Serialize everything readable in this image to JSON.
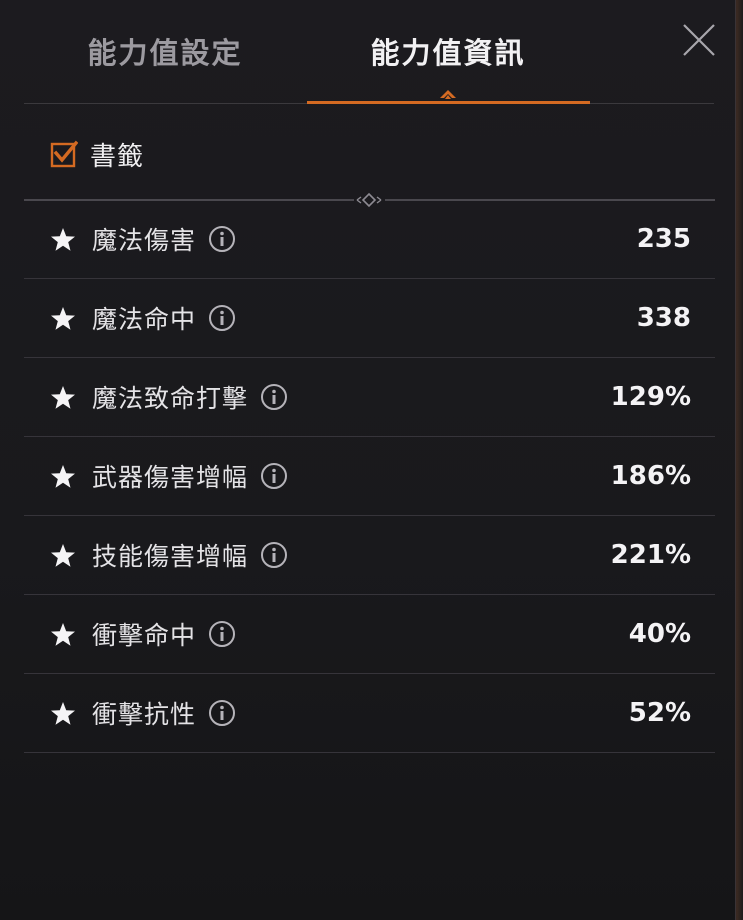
{
  "tabs": {
    "stat_settings": "能力值設定",
    "stat_info": "能力值資訊",
    "active": "stat_info"
  },
  "bookmark": {
    "label": "書籤",
    "checked": true
  },
  "stats": [
    {
      "label": "魔法傷害",
      "value": "235"
    },
    {
      "label": "魔法命中",
      "value": "338"
    },
    {
      "label": "魔法致命打擊",
      "value": "129%"
    },
    {
      "label": "武器傷害增幅",
      "value": "186%"
    },
    {
      "label": "技能傷害增幅",
      "value": "221%"
    },
    {
      "label": "衝擊命中",
      "value": "40%"
    },
    {
      "label": "衝擊抗性",
      "value": "52%"
    }
  ],
  "icons": {
    "close": "close-icon",
    "checkbox": "checkbox-checked-icon",
    "stat_star": "star-icon",
    "stat_info": "info-icon"
  },
  "colors": {
    "accent": "#d46a22",
    "active_tab_text": "#f2f1f3",
    "inactive_tab_text": "#9c9aa0",
    "panel_background": "#1c1b1f"
  }
}
